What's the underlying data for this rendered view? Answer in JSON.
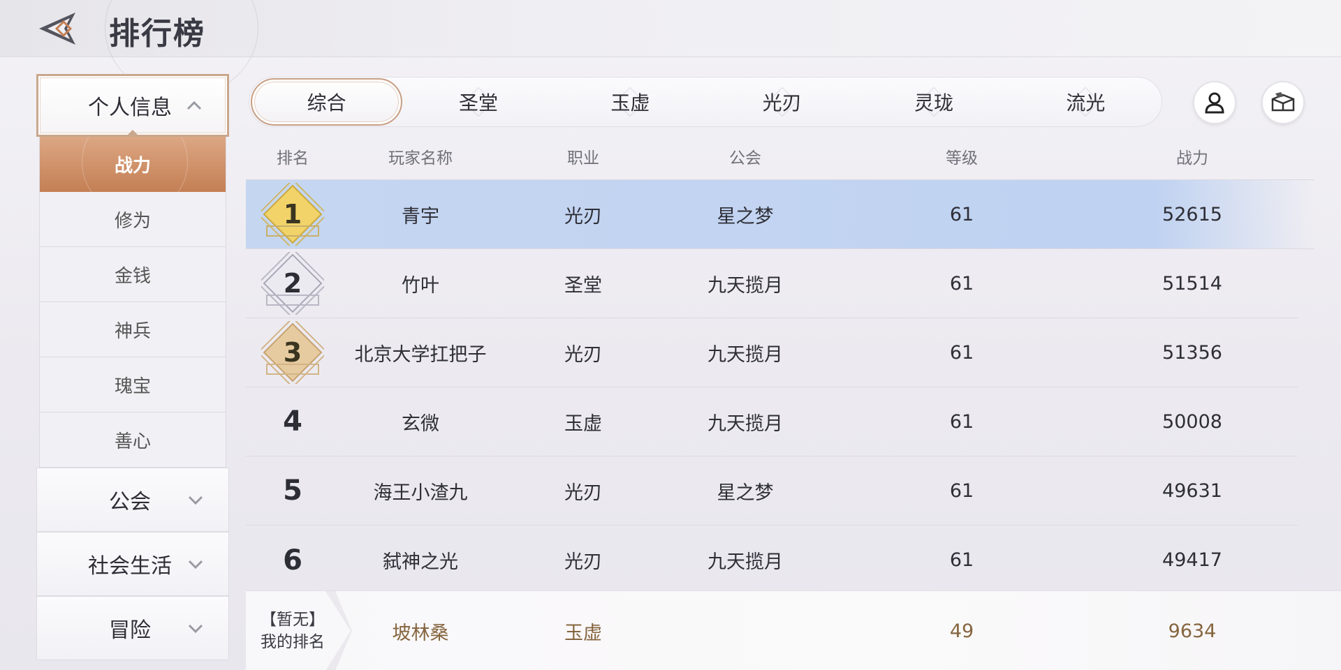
{
  "header": {
    "title": "排行榜"
  },
  "sidebar": {
    "active_group": {
      "label": "个人信息"
    },
    "sub_items": [
      "战力",
      "修为",
      "金钱",
      "神兵",
      "瑰宝",
      "善心"
    ],
    "groups": [
      "公会",
      "社会生活",
      "冒险"
    ]
  },
  "tabs": [
    "综合",
    "圣堂",
    "玉虚",
    "光刃",
    "灵珑",
    "流光"
  ],
  "table": {
    "headers": {
      "rank": "排名",
      "name": "玩家名称",
      "job": "职业",
      "guild": "公会",
      "level": "等级",
      "power": "战力"
    },
    "rows": [
      {
        "rank": "1",
        "name": "青宇",
        "job": "光刃",
        "guild": "星之梦",
        "level": "61",
        "power": "52615"
      },
      {
        "rank": "2",
        "name": "竹叶",
        "job": "圣堂",
        "guild": "九天揽月",
        "level": "61",
        "power": "51514"
      },
      {
        "rank": "3",
        "name": "北京大学扛把子",
        "job": "光刃",
        "guild": "九天揽月",
        "level": "61",
        "power": "51356"
      },
      {
        "rank": "4",
        "name": "玄微",
        "job": "玉虚",
        "guild": "九天揽月",
        "level": "61",
        "power": "50008"
      },
      {
        "rank": "5",
        "name": "海王小渣九",
        "job": "光刃",
        "guild": "星之梦",
        "level": "61",
        "power": "49631"
      },
      {
        "rank": "6",
        "name": "弑神之光",
        "job": "光刃",
        "guild": "九天揽月",
        "level": "61",
        "power": "49417"
      }
    ]
  },
  "my_rank": {
    "status": "【暂无】",
    "label": "我的排名",
    "name": "坡林桑",
    "job": "玉虚",
    "level": "49",
    "power": "9634"
  },
  "colors": {
    "accent": "#c47f54",
    "highlight_row": "#c5d6f1",
    "gold_medal": "#f2d36a",
    "silver_medal": "#d9d8e2",
    "bronze_medal": "#e3c79b",
    "my_rank_text": "#85653f"
  },
  "icons": {
    "back": "back-arrow-icon",
    "profile": "user-icon",
    "chest": "treasure-chest-icon",
    "chevron_up": "chevron-up-icon",
    "chevron_down": "chevron-down-icon"
  }
}
